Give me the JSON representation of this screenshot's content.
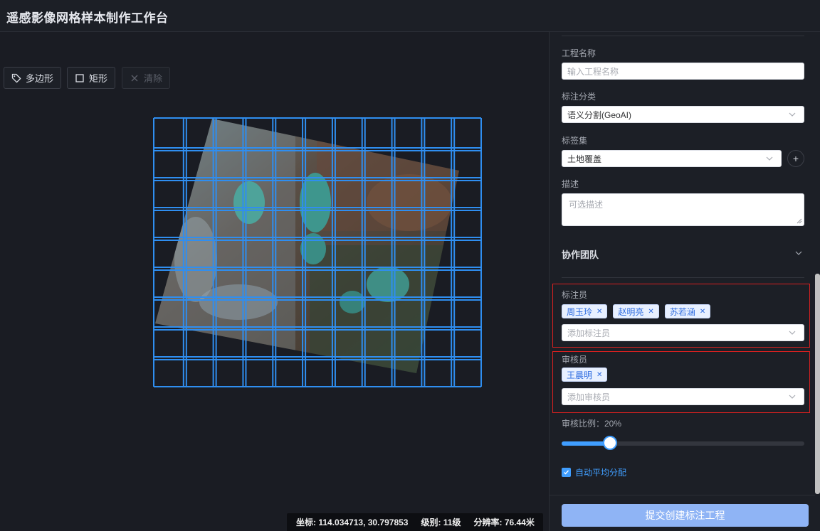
{
  "app": {
    "title": "遥感影像网格样本制作工作台"
  },
  "toolbar": {
    "polygon_label": "多边形",
    "rect_label": "矩形",
    "clear_label": "清除"
  },
  "status": {
    "coord": "坐标: 114.034713, 30.797853",
    "level": "级别: 11级",
    "resolution": "分辨率: 76.44米"
  },
  "form": {
    "project_name": {
      "label": "工程名称",
      "placeholder": "输入工程名称"
    },
    "category": {
      "label": "标注分类",
      "value": "语义分割(GeoAI)"
    },
    "label_set": {
      "label": "标签集",
      "value": "土地覆盖"
    },
    "description": {
      "label": "描述",
      "placeholder": "可选描述"
    },
    "team_section": "协作团队",
    "annotators": {
      "label": "标注员",
      "tags": [
        "周玉玲",
        "赵明亮",
        "苏若涵"
      ],
      "placeholder": "添加标注员"
    },
    "reviewers": {
      "label": "审核员",
      "tags": [
        "王晨明"
      ],
      "placeholder": "添加审核员"
    },
    "review_ratio": {
      "label": "审核比例：20%",
      "value_percent": 20
    },
    "auto_distribute": {
      "label": "自动平均分配",
      "checked": true
    },
    "submit_label": "提交创建标注工程"
  },
  "colors": {
    "accent": "#409eff",
    "grid": "#2f8ef0",
    "highlight_box": "#d72020",
    "submit_bg": "#8fb4f5"
  },
  "icons": {
    "polygon": "tag-icon",
    "rect": "square-icon",
    "clear": "close-icon"
  }
}
